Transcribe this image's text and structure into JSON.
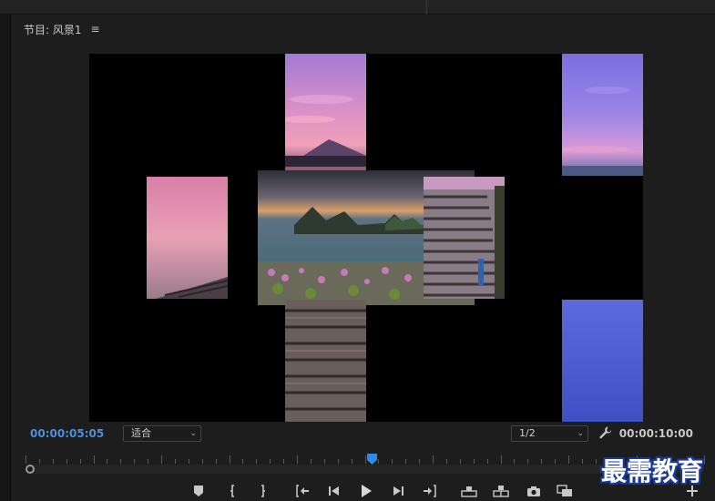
{
  "panel": {
    "title": "节目: 风景1",
    "menu_glyph": "≡"
  },
  "controls": {
    "current_timecode": "00:00:05:05",
    "total_timecode": "00:00:10:00",
    "fit_select": "适合",
    "resolution_select": "1/2"
  },
  "playhead_position": 0.51,
  "transport": {
    "buttons": [
      "add-marker",
      "mark-in",
      "mark-out",
      "go-to-in",
      "step-back",
      "play",
      "step-forward",
      "go-to-out",
      "lift",
      "extract",
      "export-frame",
      "comparison-view",
      "add-button"
    ]
  },
  "watermark": {
    "text": "最需教育"
  },
  "colors": {
    "accent_blue": "#4f8fdc",
    "panel_bg": "#1d1d1d",
    "viewport_bg": "#000000"
  }
}
